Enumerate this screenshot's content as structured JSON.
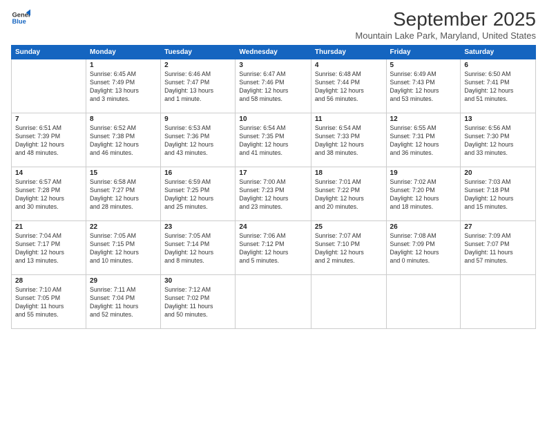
{
  "logo": {
    "line1": "General",
    "line2": "Blue"
  },
  "title": "September 2025",
  "subtitle": "Mountain Lake Park, Maryland, United States",
  "headers": [
    "Sunday",
    "Monday",
    "Tuesday",
    "Wednesday",
    "Thursday",
    "Friday",
    "Saturday"
  ],
  "weeks": [
    [
      {
        "day": "",
        "info": ""
      },
      {
        "day": "1",
        "info": "Sunrise: 6:45 AM\nSunset: 7:49 PM\nDaylight: 13 hours\nand 3 minutes."
      },
      {
        "day": "2",
        "info": "Sunrise: 6:46 AM\nSunset: 7:47 PM\nDaylight: 13 hours\nand 1 minute."
      },
      {
        "day": "3",
        "info": "Sunrise: 6:47 AM\nSunset: 7:46 PM\nDaylight: 12 hours\nand 58 minutes."
      },
      {
        "day": "4",
        "info": "Sunrise: 6:48 AM\nSunset: 7:44 PM\nDaylight: 12 hours\nand 56 minutes."
      },
      {
        "day": "5",
        "info": "Sunrise: 6:49 AM\nSunset: 7:43 PM\nDaylight: 12 hours\nand 53 minutes."
      },
      {
        "day": "6",
        "info": "Sunrise: 6:50 AM\nSunset: 7:41 PM\nDaylight: 12 hours\nand 51 minutes."
      }
    ],
    [
      {
        "day": "7",
        "info": "Sunrise: 6:51 AM\nSunset: 7:39 PM\nDaylight: 12 hours\nand 48 minutes."
      },
      {
        "day": "8",
        "info": "Sunrise: 6:52 AM\nSunset: 7:38 PM\nDaylight: 12 hours\nand 46 minutes."
      },
      {
        "day": "9",
        "info": "Sunrise: 6:53 AM\nSunset: 7:36 PM\nDaylight: 12 hours\nand 43 minutes."
      },
      {
        "day": "10",
        "info": "Sunrise: 6:54 AM\nSunset: 7:35 PM\nDaylight: 12 hours\nand 41 minutes."
      },
      {
        "day": "11",
        "info": "Sunrise: 6:54 AM\nSunset: 7:33 PM\nDaylight: 12 hours\nand 38 minutes."
      },
      {
        "day": "12",
        "info": "Sunrise: 6:55 AM\nSunset: 7:31 PM\nDaylight: 12 hours\nand 36 minutes."
      },
      {
        "day": "13",
        "info": "Sunrise: 6:56 AM\nSunset: 7:30 PM\nDaylight: 12 hours\nand 33 minutes."
      }
    ],
    [
      {
        "day": "14",
        "info": "Sunrise: 6:57 AM\nSunset: 7:28 PM\nDaylight: 12 hours\nand 30 minutes."
      },
      {
        "day": "15",
        "info": "Sunrise: 6:58 AM\nSunset: 7:27 PM\nDaylight: 12 hours\nand 28 minutes."
      },
      {
        "day": "16",
        "info": "Sunrise: 6:59 AM\nSunset: 7:25 PM\nDaylight: 12 hours\nand 25 minutes."
      },
      {
        "day": "17",
        "info": "Sunrise: 7:00 AM\nSunset: 7:23 PM\nDaylight: 12 hours\nand 23 minutes."
      },
      {
        "day": "18",
        "info": "Sunrise: 7:01 AM\nSunset: 7:22 PM\nDaylight: 12 hours\nand 20 minutes."
      },
      {
        "day": "19",
        "info": "Sunrise: 7:02 AM\nSunset: 7:20 PM\nDaylight: 12 hours\nand 18 minutes."
      },
      {
        "day": "20",
        "info": "Sunrise: 7:03 AM\nSunset: 7:18 PM\nDaylight: 12 hours\nand 15 minutes."
      }
    ],
    [
      {
        "day": "21",
        "info": "Sunrise: 7:04 AM\nSunset: 7:17 PM\nDaylight: 12 hours\nand 13 minutes."
      },
      {
        "day": "22",
        "info": "Sunrise: 7:05 AM\nSunset: 7:15 PM\nDaylight: 12 hours\nand 10 minutes."
      },
      {
        "day": "23",
        "info": "Sunrise: 7:05 AM\nSunset: 7:14 PM\nDaylight: 12 hours\nand 8 minutes."
      },
      {
        "day": "24",
        "info": "Sunrise: 7:06 AM\nSunset: 7:12 PM\nDaylight: 12 hours\nand 5 minutes."
      },
      {
        "day": "25",
        "info": "Sunrise: 7:07 AM\nSunset: 7:10 PM\nDaylight: 12 hours\nand 2 minutes."
      },
      {
        "day": "26",
        "info": "Sunrise: 7:08 AM\nSunset: 7:09 PM\nDaylight: 12 hours\nand 0 minutes."
      },
      {
        "day": "27",
        "info": "Sunrise: 7:09 AM\nSunset: 7:07 PM\nDaylight: 11 hours\nand 57 minutes."
      }
    ],
    [
      {
        "day": "28",
        "info": "Sunrise: 7:10 AM\nSunset: 7:05 PM\nDaylight: 11 hours\nand 55 minutes."
      },
      {
        "day": "29",
        "info": "Sunrise: 7:11 AM\nSunset: 7:04 PM\nDaylight: 11 hours\nand 52 minutes."
      },
      {
        "day": "30",
        "info": "Sunrise: 7:12 AM\nSunset: 7:02 PM\nDaylight: 11 hours\nand 50 minutes."
      },
      {
        "day": "",
        "info": ""
      },
      {
        "day": "",
        "info": ""
      },
      {
        "day": "",
        "info": ""
      },
      {
        "day": "",
        "info": ""
      }
    ]
  ]
}
